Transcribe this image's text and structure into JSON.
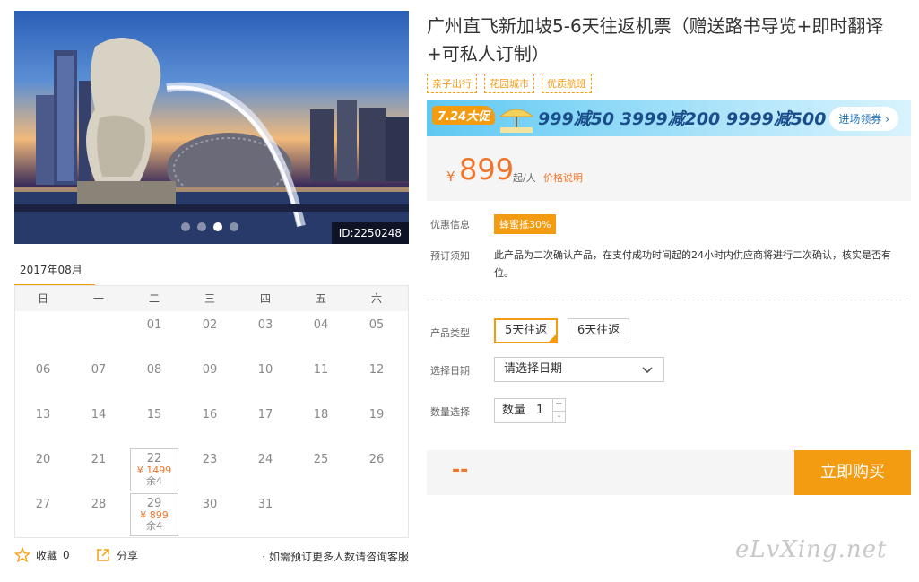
{
  "hero": {
    "id_tag": "ID:2250248",
    "slide_count": 4,
    "active_slide": 3
  },
  "calendar": {
    "month": "2017年08月",
    "weekdays": [
      "日",
      "一",
      "二",
      "三",
      "四",
      "五",
      "六"
    ],
    "days": [
      {
        "d": ""
      },
      {
        "d": ""
      },
      {
        "d": "01"
      },
      {
        "d": "02"
      },
      {
        "d": "03"
      },
      {
        "d": "04"
      },
      {
        "d": "05"
      },
      {
        "d": "06"
      },
      {
        "d": "07"
      },
      {
        "d": "08"
      },
      {
        "d": "09"
      },
      {
        "d": "10"
      },
      {
        "d": "11"
      },
      {
        "d": "12"
      },
      {
        "d": "13"
      },
      {
        "d": "14"
      },
      {
        "d": "15"
      },
      {
        "d": "16"
      },
      {
        "d": "17"
      },
      {
        "d": "18"
      },
      {
        "d": "19"
      },
      {
        "d": "20"
      },
      {
        "d": "21"
      },
      {
        "d": "22",
        "price": "¥ 1499",
        "left": "余4"
      },
      {
        "d": "23"
      },
      {
        "d": "24"
      },
      {
        "d": "25"
      },
      {
        "d": "26"
      },
      {
        "d": "27"
      },
      {
        "d": "28"
      },
      {
        "d": "29",
        "price": "¥ 899",
        "left": "余4"
      },
      {
        "d": "30"
      },
      {
        "d": "31"
      },
      {
        "d": ""
      },
      {
        "d": ""
      }
    ]
  },
  "actions": {
    "favorite_label": "收藏",
    "favorite_count": "0",
    "share_label": "分享",
    "note": "· 如需预订更多人数请咨询客服"
  },
  "product": {
    "title": "广州直飞新加坡5-6天往返机票（赠送路书导览+即时翻译+可私人订制）",
    "tags": [
      "亲子出行",
      "花园城市",
      "优质航班"
    ]
  },
  "banner": {
    "badge": "7.24大促",
    "promo": "999减50  3999减200  9999减500",
    "button": "进场领券 ›"
  },
  "price": {
    "yen": "¥",
    "amount": "899",
    "unit": "起/人",
    "link": "价格说明"
  },
  "info": {
    "discount_label": "优惠信息",
    "discount_badge": "蜂蜜抵30%",
    "notice_label": "预订须知",
    "notice_text": "此产品为二次确认产品，在支付成功时间起的24小时内供应商将进行二次确认，核实是否有位。"
  },
  "options": {
    "type_label": "产品类型",
    "types": [
      "5天往返",
      "6天往返"
    ],
    "date_label": "选择日期",
    "date_placeholder": "请选择日期",
    "qty_label": "数量选择",
    "qty_text": "数量",
    "qty_value": "1"
  },
  "purchase": {
    "total": "--",
    "button": "立即购买"
  },
  "watermark": "eLvXing.net",
  "colors": {
    "accent": "#f39c12",
    "price": "#f0752a",
    "banner_text": "#1a4e8a"
  }
}
